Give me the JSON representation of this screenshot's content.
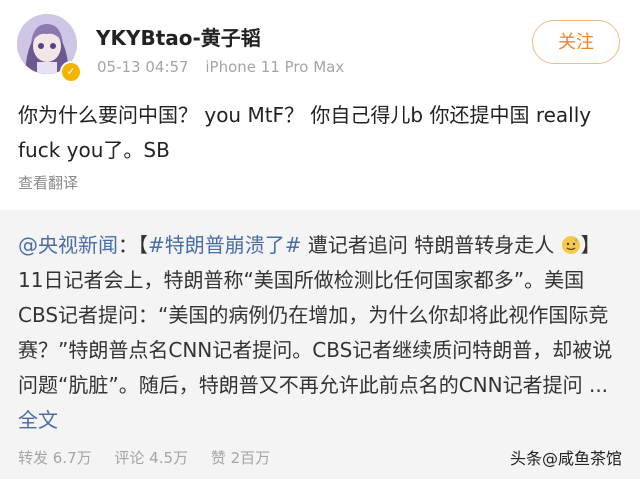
{
  "post": {
    "username": "YKYBtao-黄子韬",
    "time": "05-13 04:57",
    "device": "iPhone 11 Pro Max",
    "follow_label": "关注",
    "text": "你为什么要问中国？ you MtF？ 你自己得儿b 你还提中国 really fuck you了。SB",
    "translate_label": "查看翻译"
  },
  "repost": {
    "source": "@央视新闻",
    "colon_bracket": "：【",
    "hashtag": "#特朗普崩溃了#",
    "lead": " 遭记者追问 特朗普转身走人",
    "body": "】11日记者会上，特朗普称“美国所做检测比任何国家都多”。美国CBS记者提问：“美国的病例仍在增加，为什么你却将此视作国际竞赛？”特朗普点名CNN记者提问。CBS记者继续质问特朗普，却被说问题“肮脏”。随后，特朗普又不再允许此前点名的CNN记者提问 ",
    "ellipsis": "... ",
    "full_text_label": "全文",
    "emoji": "sweat-smile-emoji"
  },
  "stats": {
    "reposts": "转发 6.7万",
    "comments": "评论 4.5万",
    "likes": "赞 2百万"
  },
  "watermark": "头条@咸鱼茶馆",
  "colors": {
    "link": "#4a6ea4",
    "follow": "#f08330",
    "verified": "#f5b400",
    "repost_bg": "#f4f4f4"
  }
}
